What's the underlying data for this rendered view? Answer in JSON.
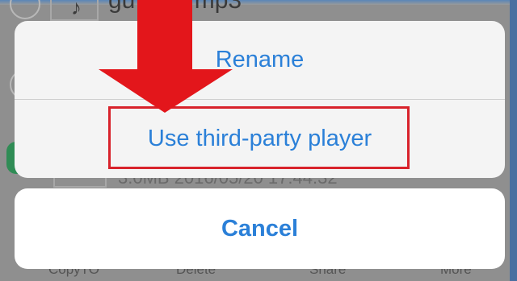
{
  "background": {
    "filename": "gu...gin.mp3",
    "note_glyph": "♪",
    "meta": "3.0MB 2016/05/20 17:44:32",
    "toolbar": [
      "CopyTO",
      "Delete",
      "Share",
      "More"
    ]
  },
  "action_sheet": {
    "items": [
      "Rename",
      "Use third-party player"
    ],
    "cancel": "Cancel"
  },
  "annotation": {
    "arrow_color": "#e3161b",
    "highlight_color": "#d8222b"
  },
  "colors": {
    "ios_blue": "#2b80d8"
  }
}
